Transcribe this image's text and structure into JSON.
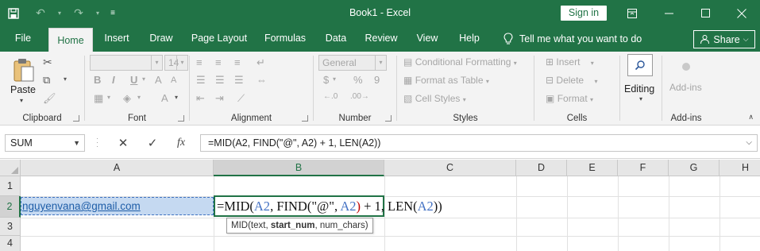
{
  "window": {
    "title": "Book1  -  Excel",
    "sign_in": "Sign in",
    "share": "Share"
  },
  "tabs": [
    "File",
    "Home",
    "Insert",
    "Draw",
    "Page Layout",
    "Formulas",
    "Data",
    "Review",
    "View",
    "Help"
  ],
  "active_tab": "Home",
  "tell_me": "Tell me what you want to do",
  "ribbon": {
    "clipboard": {
      "label": "Clipboard",
      "paste": "Paste"
    },
    "font": {
      "label": "Font",
      "font_name": "",
      "font_size": "14",
      "bold": "B",
      "italic": "I",
      "underline": "U"
    },
    "alignment": {
      "label": "Alignment"
    },
    "number": {
      "label": "Number",
      "format": "General",
      "currency": "$",
      "percent": "%",
      "comma": "9"
    },
    "styles": {
      "label": "Styles",
      "conditional": "Conditional Formatting",
      "format_table": "Format as Table",
      "cell_styles": "Cell Styles"
    },
    "cells": {
      "label": "Cells",
      "insert": "Insert",
      "delete": "Delete",
      "format": "Format"
    },
    "editing": {
      "label": "Editing"
    },
    "addins": {
      "label": "Add-ins",
      "button": "Add-ins"
    }
  },
  "formula_bar": {
    "name_box": "SUM",
    "cancel": "✕",
    "enter": "✓",
    "fx": "fx",
    "formula": "=MID(A2, FIND(\"@\", A2) + 1, LEN(A2))"
  },
  "grid": {
    "columns": [
      "A",
      "B",
      "C",
      "D",
      "E",
      "F",
      "G",
      "H"
    ],
    "rows": [
      "1",
      "2",
      "3",
      "4"
    ],
    "cells": {
      "A2": "nguyenvana@gmail.com",
      "B2_parts": [
        "=MID(",
        "A2",
        ", FIND(",
        "\"@\"",
        ", ",
        "A2",
        ")",
        " + 1, LEN(",
        "A2",
        "))"
      ]
    },
    "tooltip": {
      "prefix": "MID(text, ",
      "bold": "start_num",
      "suffix": ", num_chars)"
    }
  },
  "colors": {
    "excel_green": "#217346",
    "ribbon_bg": "#f3f3f3",
    "selection_fill": "#c5d9f1",
    "ref_blue": "#4472c4",
    "ref_red": "#c00000"
  }
}
